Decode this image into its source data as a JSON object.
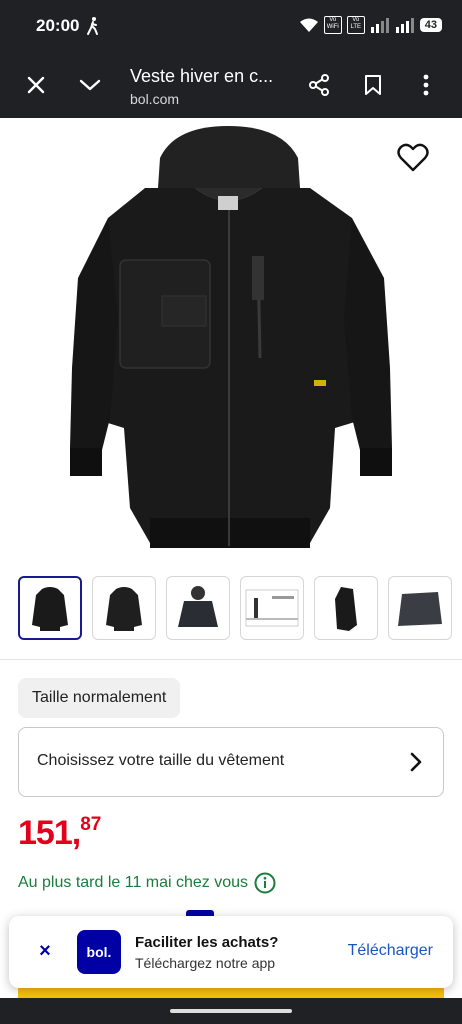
{
  "status_bar": {
    "time": "20:00",
    "net1_top": "Vo",
    "net1_bottom": "WiFi",
    "net2_top": "Vo",
    "net2_bottom": "LTE",
    "battery": "43"
  },
  "toolbar": {
    "title": "Veste hiver en c...",
    "url": "bol.com"
  },
  "product": {
    "thumbnails_count": 6,
    "size_chip": "Taille normalement",
    "size_select_label": "Choisissez votre taille du vêtement",
    "price_int": "151,",
    "price_dec": "87",
    "delivery": "Au plus tard le 11 mai chez vous"
  },
  "banner": {
    "logo": "bol.",
    "title": "Faciliter les achats?",
    "subtitle": "Téléchargez notre app",
    "cta": "Télécharger",
    "close": "×"
  },
  "colors": {
    "price": "#e3001b",
    "delivery": "#1a7d3b",
    "brand_blue": "#0000a4",
    "cta_blue": "#1a55c4"
  },
  "icons": [
    "walking-icon",
    "wifi-icon",
    "signal-icon",
    "close-icon",
    "chevron-down-icon",
    "share-icon",
    "bookmark-icon",
    "more-vert-icon",
    "heart-icon",
    "chevron-right-icon",
    "info-icon"
  ]
}
